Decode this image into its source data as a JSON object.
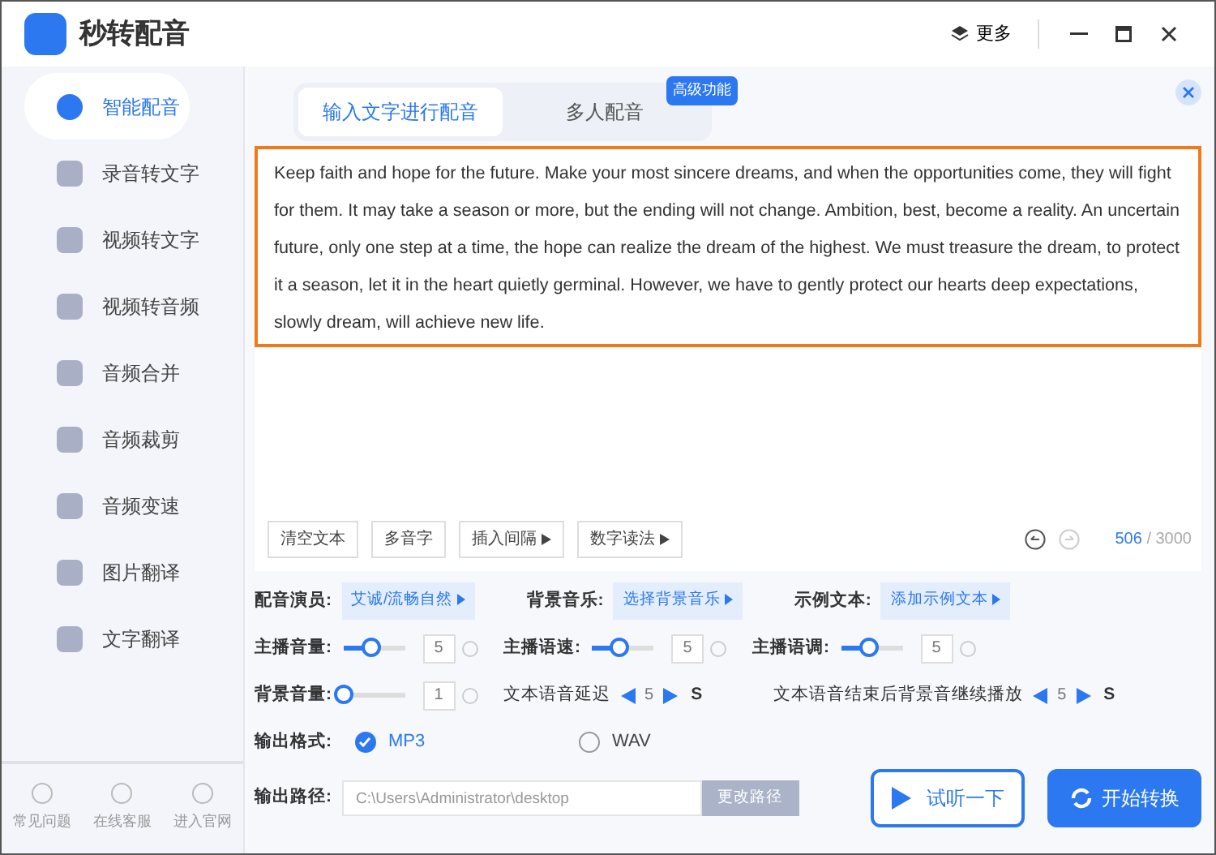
{
  "window": {
    "title": "秒转配音",
    "more": "更多"
  },
  "sidebar": {
    "items": [
      {
        "label": "智能配音",
        "selected": true
      },
      {
        "label": "录音转文字",
        "selected": false
      },
      {
        "label": "视频转文字",
        "selected": false
      },
      {
        "label": "视频转音频",
        "selected": false
      },
      {
        "label": "音频合并",
        "selected": false
      },
      {
        "label": "音频裁剪",
        "selected": false
      },
      {
        "label": "音频变速",
        "selected": false
      },
      {
        "label": "图片翻译",
        "selected": false
      },
      {
        "label": "文字翻译",
        "selected": false
      }
    ],
    "footer": [
      "常见问题",
      "在线客服",
      "进入官网"
    ]
  },
  "tabs": [
    {
      "label": "输入文字进行配音",
      "selected": true
    },
    {
      "label": "多人配音",
      "selected": false
    }
  ],
  "badge": "高级功能",
  "text": "Keep faith and hope for the future. Make your most sincere dreams, and when the opportunities come, they will fight for them. It may take a season or more, but the ending will not change. Ambition, best, become a reality. An uncertain future, only one step at a time, the hope can realize the dream of the highest. We must treasure the dream, to protect it a season, let it in the heart quietly germinal. However, we have to gently protect our hearts deep expectations, slowly dream, will achieve new life.",
  "tools": [
    {
      "label": "清空文本",
      "menu": false
    },
    {
      "label": "多音字",
      "menu": false
    },
    {
      "label": "插入间隔",
      "menu": true
    },
    {
      "label": "数字读法",
      "menu": true
    }
  ],
  "counter": {
    "count": "506",
    "max": "/ 3000"
  },
  "pickers": [
    {
      "label": "配音演员:",
      "value": "艾诚/流畅自然"
    },
    {
      "label": "背景音乐:",
      "value": "选择背景音乐"
    },
    {
      "label": "示例文本:",
      "value": "添加示例文本"
    }
  ],
  "sliders": [
    {
      "label": "主播音量:",
      "level": 0.45,
      "value": "5"
    },
    {
      "label": "主播语速:",
      "level": 0.45,
      "value": "5"
    },
    {
      "label": "主播语调:",
      "level": 0.45,
      "value": "5"
    }
  ],
  "bg_volume": {
    "label": "背景音量:",
    "level": 0,
    "value": "1"
  },
  "steppers": [
    {
      "label": "文本语音延迟",
      "value": "5",
      "unit": "S"
    },
    {
      "label": "文本语音结束后背景音继续播放",
      "value": "5",
      "unit": "S"
    }
  ],
  "format": {
    "label": "输出格式:",
    "options": [
      {
        "label": "MP3",
        "selected": true
      },
      {
        "label": "WAV",
        "selected": false
      }
    ]
  },
  "path": {
    "label": "输出路径:",
    "value": "C:\\Users\\Administrator\\desktop",
    "button": "更改路径"
  },
  "preview_button": "试听一下",
  "start_button": "开始转换"
}
